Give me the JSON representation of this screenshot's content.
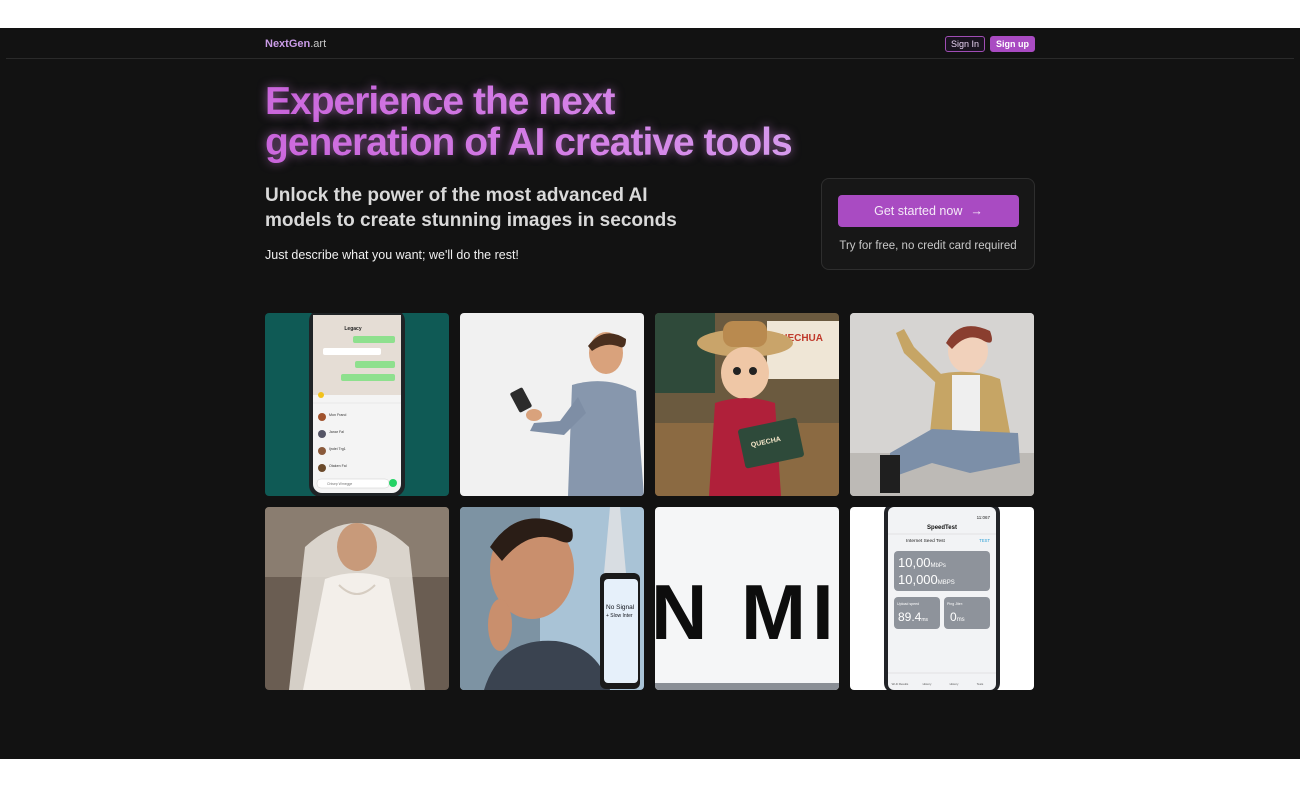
{
  "nav": {
    "brand": "NextGen",
    "brand_suffix": ".art",
    "sign_in": "Sign In",
    "sign_up": "Sign up"
  },
  "hero": {
    "title_line1": "Experience the next",
    "title_line2": "generation of AI creative tools",
    "subtitle_line1": "Unlock the power of the most advanced AI",
    "subtitle_line2": "models to create stunning images in seconds",
    "tagline": "Just describe what you want; we'll do the rest!"
  },
  "cta": {
    "button_label": "Get started now",
    "arrow": "→",
    "note": "Try for free, no credit card required"
  },
  "gallery": {
    "chat_app": {
      "header": "Legacy",
      "rows": [
        "Mon Frand",
        "Janar Fal",
        "Ijndei Trg1",
        "Otaken Fal"
      ],
      "input": "Chtsep Wmegge"
    },
    "pinocchio": {
      "sign": "ANECHUA",
      "book": "QUECHA"
    },
    "blurred_text": "N MITI",
    "speed_test": {
      "time": "11:067",
      "app_title": "SpeedTest",
      "subtitle": "Internet Seed Test",
      "test_label": "TEST",
      "value1": "10,00",
      "unit1": "MbPs",
      "value2": "10,000",
      "unit2": "MBPS",
      "upload_label": "Upload speed",
      "upload_value": "89.4",
      "upload_unit": "ms",
      "ping_label": "Ping Jiter:",
      "ping_value": "0",
      "ping_unit": "ms",
      "tabs": [
        "Wi-Fi Results",
        "History",
        "History",
        "Tests"
      ]
    },
    "no_signal": {
      "line1": "No Signal",
      "line2": "+ Slow Inter"
    }
  },
  "colors": {
    "background": "#121212",
    "accent": "#a94bc2",
    "title_gradient_start": "#c45bd6",
    "title_gradient_end": "#d6b1f2"
  }
}
